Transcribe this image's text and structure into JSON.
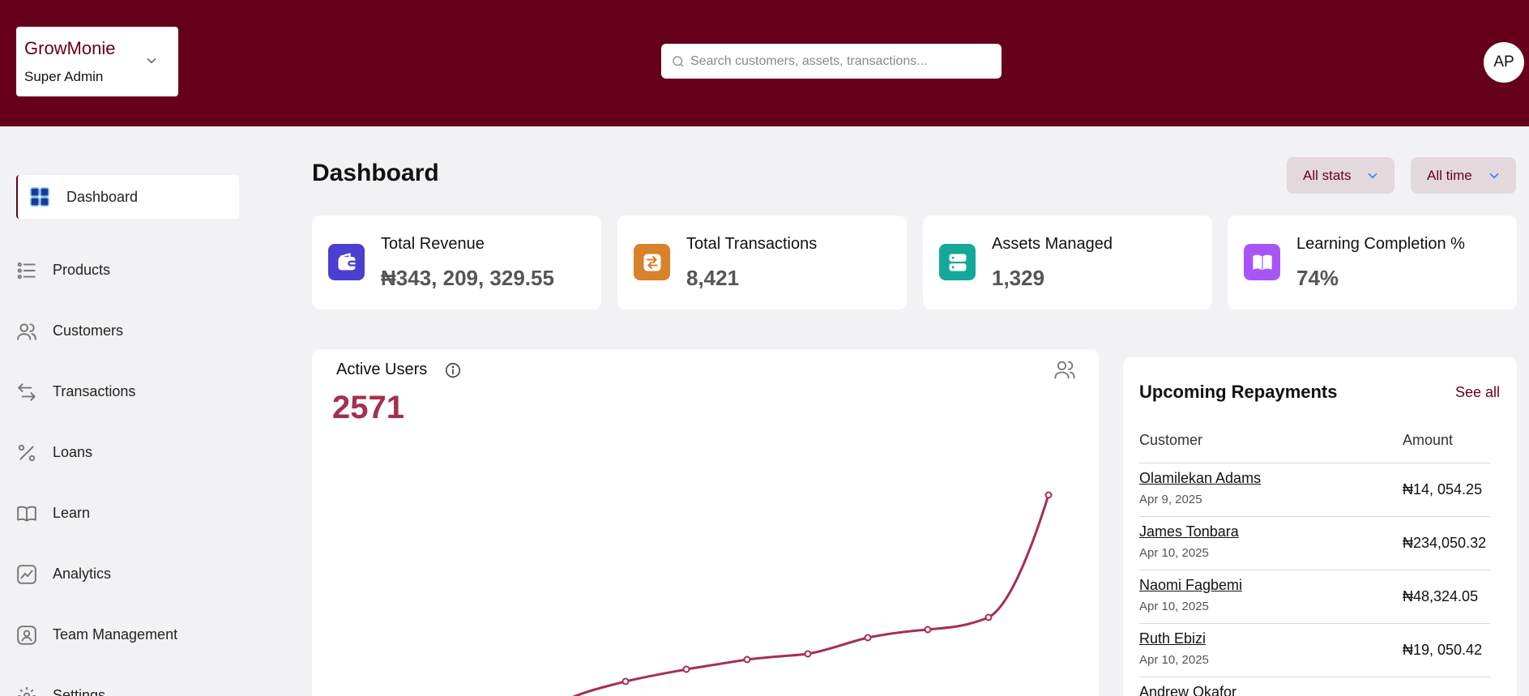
{
  "header": {
    "brand_name": "GrowMonie",
    "brand_role": "Super Admin",
    "search_placeholder": "Search customers, assets, transactions...",
    "avatar_initials": "AP"
  },
  "sidebar": {
    "items": [
      {
        "label": "Dashboard",
        "icon": "grid-icon",
        "active": true
      },
      {
        "label": "Products",
        "icon": "list-icon"
      },
      {
        "label": "Customers",
        "icon": "users-icon"
      },
      {
        "label": "Transactions",
        "icon": "arrows-icon"
      },
      {
        "label": "Loans",
        "icon": "percent-icon"
      },
      {
        "label": "Learn",
        "icon": "book-icon"
      },
      {
        "label": "Analytics",
        "icon": "chart-icon"
      },
      {
        "label": "Team Management",
        "icon": "person-badge-icon"
      },
      {
        "label": "Settings",
        "icon": "gear-icon"
      }
    ]
  },
  "main": {
    "title": "Dashboard",
    "filters": {
      "stats": "All stats",
      "time": "All time"
    },
    "stats": [
      {
        "label": "Total Revenue",
        "value": "₦343, 209, 329.55",
        "icon": "wallet-icon",
        "color": "#4a3fd1"
      },
      {
        "label": "Total Transactions",
        "value": "8,421",
        "icon": "transfer-icon",
        "color": "#d9822b"
      },
      {
        "label": "Assets Managed",
        "value": "1,329",
        "icon": "server-icon",
        "color": "#14a89a"
      },
      {
        "label": "Learning Completion %",
        "value": "74%",
        "icon": "open-book-icon",
        "color": "#a855f7"
      }
    ],
    "active_users": {
      "title": "Active Users",
      "value": "2571",
      "line_color": "#a3304f"
    },
    "repayments": {
      "title": "Upcoming Repayments",
      "see_all": "See all",
      "col_customer": "Customer",
      "col_amount": "Amount",
      "rows": [
        {
          "name": "Olamilekan Adams",
          "date": "Apr 9, 2025",
          "amount": "₦14, 054.25"
        },
        {
          "name": "James Tonbara",
          "date": "Apr 10, 2025",
          "amount": "₦234,050.32"
        },
        {
          "name": "Naomi Fagbemi",
          "date": "Apr 10, 2025",
          "amount": "₦48,324.05"
        },
        {
          "name": "Ruth Ebizi",
          "date": "Apr 10, 2025",
          "amount": "₦19, 050.42"
        },
        {
          "name": "Andrew Okafor",
          "date": "",
          "amount": ""
        }
      ]
    }
  }
}
